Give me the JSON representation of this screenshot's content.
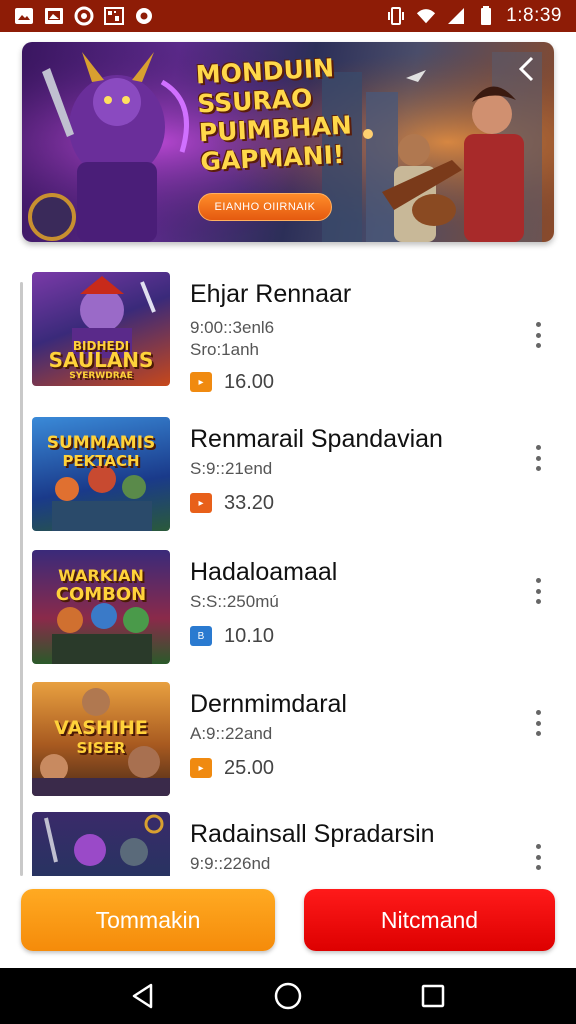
{
  "status_bar": {
    "time": "1:8:39",
    "left_icons": [
      "photo-icon",
      "image-icon",
      "circle-icon",
      "qr-icon",
      "settings-icon"
    ],
    "right_icons": [
      "vibrate-icon",
      "wifi-icon",
      "signal-icon",
      "battery-icon"
    ],
    "background": "#8e1c06"
  },
  "banner": {
    "title_lines": [
      "MONDUIN",
      "SSURAO",
      "PUIMBHAN",
      "GAPMANI!"
    ],
    "cta_label": "EIANHO OIIRNAIK",
    "accent": "#ff8c2a"
  },
  "games": [
    {
      "title": "Ehjar Rennaar",
      "meta_line1": "9:00::3enl6",
      "meta_line2": "Sro:1anh",
      "price": "16.00",
      "badge_color": "#f08a10",
      "badge_icon": "play-badge-icon",
      "thumb_lines": [
        "BIDHEDI",
        "SAULANS",
        "SYERWDRAE"
      ],
      "thumb_bg": [
        "#6a2c8a",
        "#b8421e"
      ]
    },
    {
      "title": "Renmarail Spandavian",
      "meta_line1": "S:9::21end",
      "meta_line2": "",
      "price": "33.20",
      "badge_color": "#e8601a",
      "badge_icon": "play-badge-icon",
      "thumb_lines": [
        "SUMMAMIS",
        "PEKTACH"
      ],
      "thumb_bg": [
        "#1a4a9a",
        "#2a7ac0"
      ]
    },
    {
      "title": "Hadaloamaal",
      "meta_line1": "S:S::250mú",
      "meta_line2": "",
      "price": "10.10",
      "badge_color": "#2a7ad0",
      "badge_icon": "b-badge-icon",
      "thumb_lines": [
        "WARKIAN",
        "COMBON"
      ],
      "thumb_bg": [
        "#2c2a6a",
        "#a83a2a"
      ]
    },
    {
      "title": "Dernmimdaral",
      "meta_line1": "A:9::22and",
      "meta_line2": "",
      "price": "25.00",
      "badge_color": "#f08a10",
      "badge_icon": "play-badge-icon",
      "thumb_lines": [
        "VASHIHE",
        "SISER"
      ],
      "thumb_bg": [
        "#c86a20",
        "#7a3a18"
      ]
    },
    {
      "title": "Radainsall Spradarsin",
      "meta_line1": "9:9::226nd",
      "meta_line2": "",
      "price": "",
      "badge_color": "#f08a10",
      "badge_icon": "play-badge-icon",
      "thumb_lines": [],
      "thumb_bg": [
        "#3a2a6a",
        "#1a3a5a"
      ]
    }
  ],
  "buttons": {
    "left_label": "Tommakin",
    "right_label": "Nitcmand",
    "left_color": "#f9a11b",
    "right_color": "#ee0606"
  },
  "nav": {
    "icons": [
      "back-triangle-icon",
      "home-circle-icon",
      "recents-square-icon"
    ]
  }
}
